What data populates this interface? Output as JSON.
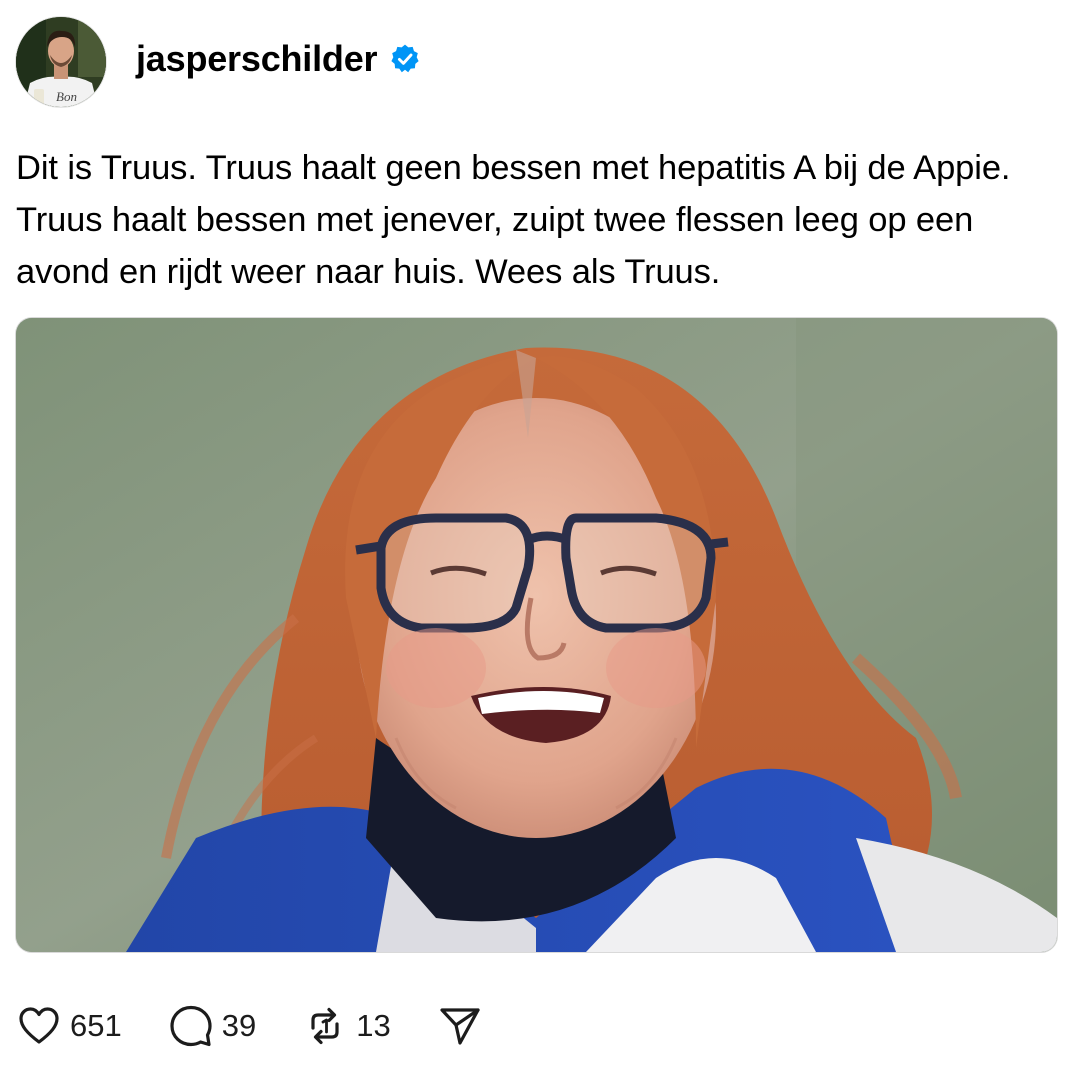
{
  "post": {
    "author": {
      "username": "jasperschilder",
      "verified": true,
      "avatar_icon": "profile-photo",
      "avatar_shirt_text": "Bon"
    },
    "caption": "Dit is Truus. Truus haalt geen bessen met hepatitis A bij de Appie. Truus haalt bessen met jenever, zuipt twee flessen leeg op een avond en rijdt weer naar huis. Wees als Truus.",
    "media": {
      "icon": "photo-laughing-woman-red-hair-glasses"
    },
    "actions": {
      "like": {
        "icon": "heart-icon",
        "count": "651"
      },
      "reply": {
        "icon": "speech-bubble-icon",
        "count": "39"
      },
      "repost": {
        "icon": "repost-icon",
        "count": "13"
      },
      "share": {
        "icon": "send-icon"
      }
    }
  },
  "colors": {
    "verified_blue": "#0095f6",
    "text": "#000000",
    "icon_gray": "#1c1c1c"
  }
}
